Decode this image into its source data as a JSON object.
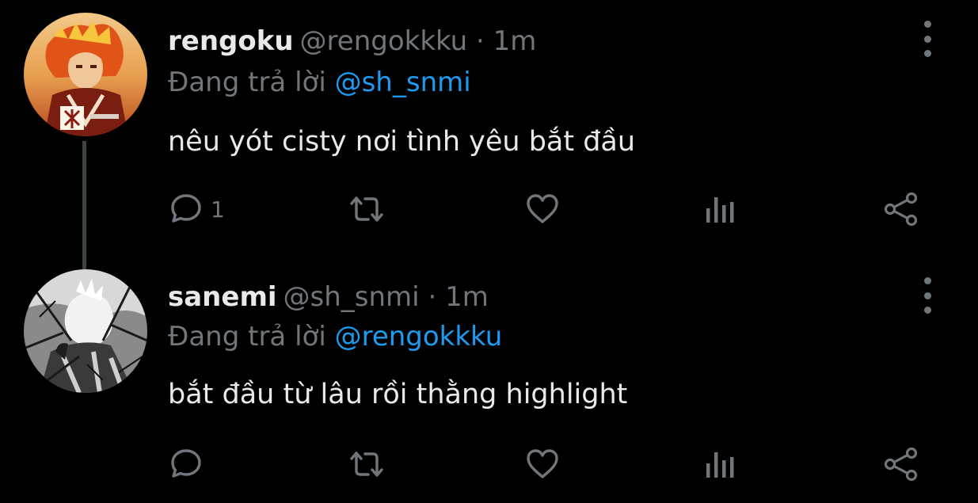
{
  "tweets": [
    {
      "display_name": "rengoku",
      "handle": "@rengokkku",
      "separator": "·",
      "time": "1m",
      "reply_prefix": "Đang trả lời",
      "reply_to": "@sh_snmi",
      "text": "nêu yót cisty nơi tình yêu bắt đầu",
      "reply_count": "1",
      "avatar": "rengoku-avatar"
    },
    {
      "display_name": "sanemi",
      "handle": "@sh_snmi",
      "separator": "·",
      "time": "1m",
      "reply_prefix": "Đang trả lời",
      "reply_to": "@rengokkku",
      "text": "bắt đầu từ lâu rồi thằng highlight",
      "reply_count": "",
      "avatar": "sanemi-avatar"
    }
  ],
  "icons": {
    "reply": "reply-icon",
    "retweet": "retweet-icon",
    "like": "heart-icon",
    "views": "analytics-icon",
    "share": "share-icon",
    "more": "more-vertical-icon"
  },
  "colors": {
    "background": "#000000",
    "primary_text": "#e7e9ea",
    "secondary_text": "#71767b",
    "accent": "#1d9bf0",
    "thread_line": "#3d4247"
  }
}
